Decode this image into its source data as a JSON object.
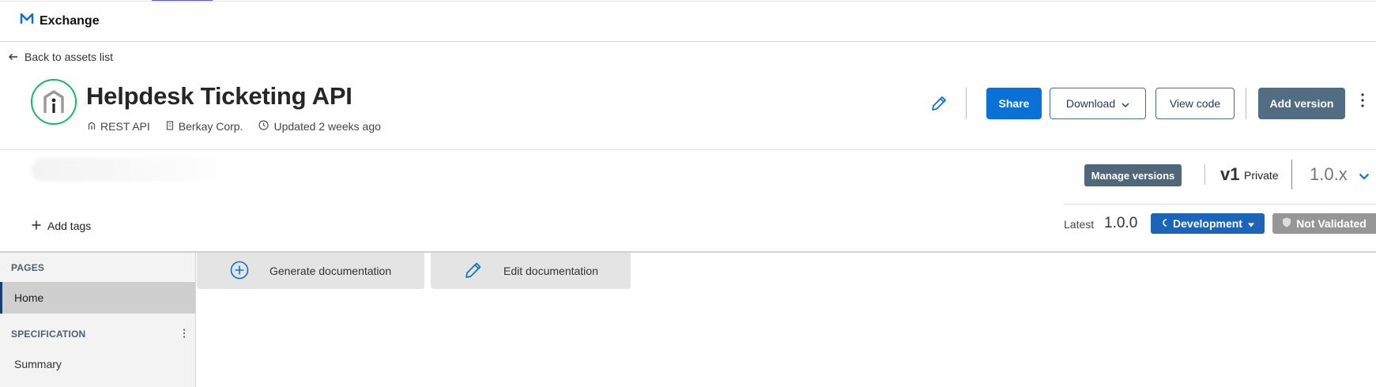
{
  "app": {
    "brand": "Exchange"
  },
  "nav": {
    "back_label": "Back to assets list"
  },
  "asset": {
    "title": "Helpdesk Ticketing API",
    "type": "REST API",
    "org": "Berkay Corp.",
    "updated": "Updated 2 weeks ago"
  },
  "toolbar": {
    "share": "Share",
    "download": "Download",
    "view_code": "View code",
    "add_version": "Add version"
  },
  "versions": {
    "manage_label": "Manage versions",
    "major": "v1",
    "visibility": "Private",
    "selected": "1.0.x",
    "latest_label": "Latest",
    "latest_value": "1.0.0",
    "lifecycle": "Development",
    "validation": "Not Validated"
  },
  "tags": {
    "add_label": "Add tags"
  },
  "sidebar": {
    "pages_title": "PAGES",
    "pages": [
      {
        "label": "Home"
      }
    ],
    "spec_title": "SPECIFICATION",
    "spec_items": [
      {
        "label": "Summary"
      }
    ]
  },
  "docs": {
    "generate": "Generate documentation",
    "edit": "Edit documentation"
  },
  "colors": {
    "primary": "#0a72d6",
    "secondary_dark": "#526d82",
    "lifecycle": "#1b64b7",
    "validation": "#969696",
    "asset_ring": "#18b764"
  }
}
